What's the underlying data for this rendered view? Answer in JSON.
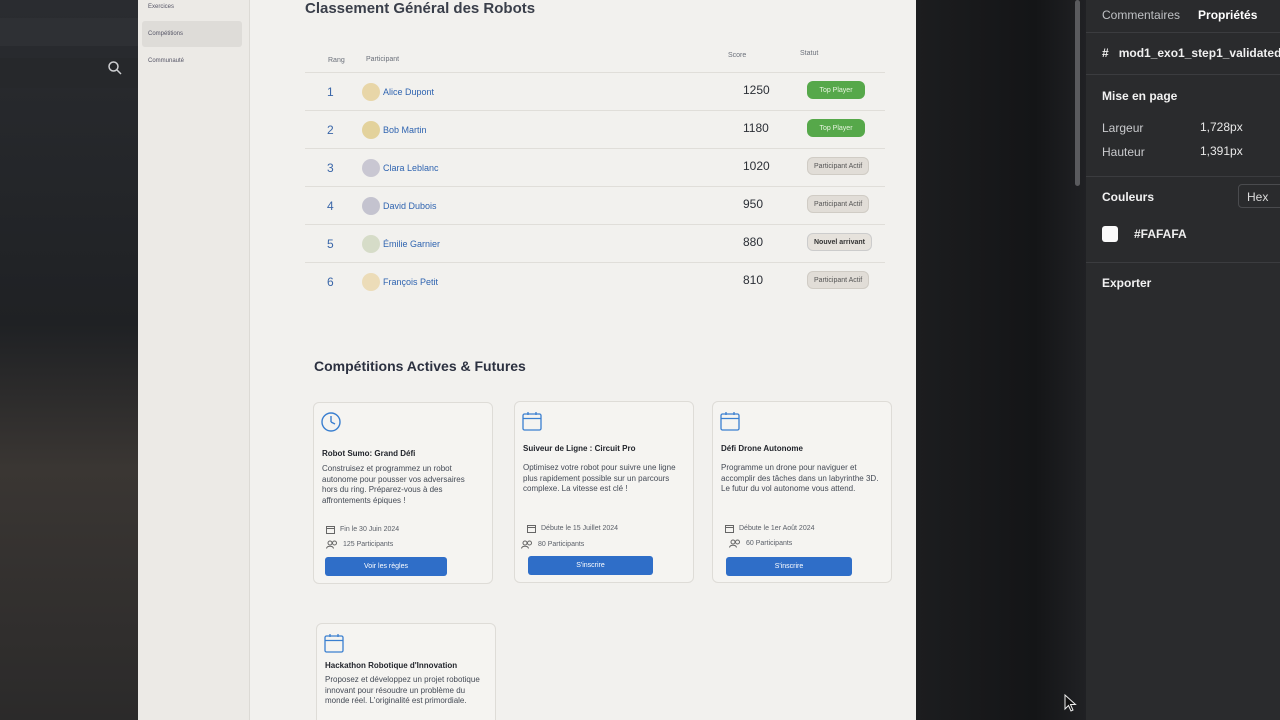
{
  "app_sidebar": {
    "items": [
      {
        "label": "Exercices"
      },
      {
        "label": "Compétitions"
      },
      {
        "label": "Communauté"
      }
    ]
  },
  "leaderboard": {
    "title": "Classement Général des Robots",
    "columns": {
      "rank": "Rang",
      "participant": "Participant",
      "score": "Score",
      "status": "Statut"
    },
    "rows": [
      {
        "rank": "1",
        "name": "Alice Dupont",
        "score": "1250",
        "status": "Top Player",
        "avatar_color": "#e8d6a8"
      },
      {
        "rank": "2",
        "name": "Bob Martin",
        "score": "1180",
        "status": "Top Player",
        "avatar_color": "#e3d29c"
      },
      {
        "rank": "3",
        "name": "Clara Leblanc",
        "score": "1020",
        "status": "Participant Actif",
        "avatar_color": "#c9c7d2"
      },
      {
        "rank": "4",
        "name": "David Dubois",
        "score": "950",
        "status": "Participant Actif",
        "avatar_color": "#c4c3cf"
      },
      {
        "rank": "5",
        "name": "Émilie Garnier",
        "score": "880",
        "status": "Nouvel arrivant",
        "avatar_color": "#d6dcc8"
      },
      {
        "rank": "6",
        "name": "François Petit",
        "score": "810",
        "status": "Participant Actif",
        "avatar_color": "#ecdcb8"
      }
    ]
  },
  "competitions": {
    "title": "Compétitions Actives & Futures",
    "cards": [
      {
        "title": "Robot Sumo: Grand Défi",
        "desc": "Construisez et programmez un robot autonome pour pousser vos adversaires hors du ring. Préparez-vous à des affrontements épiques !",
        "date": "Fin le 30 Juin 2024",
        "participants": "125 Participants",
        "button": "Voir les règles",
        "icon": "clock-icon"
      },
      {
        "title": "Suiveur de Ligne : Circuit Pro",
        "desc": "Optimisez votre robot pour suivre une ligne plus rapidement possible sur un parcours complexe. La vitesse est clé !",
        "date": "Débute le 15 Juillet 2024",
        "participants": "80 Participants",
        "button": "S'inscrire",
        "icon": "calendar-icon"
      },
      {
        "title": "Défi Drone Autonome",
        "desc": "Programme un drone pour naviguer et accomplir des tâches dans un labyrinthe 3D. Le futur du vol autonome vous attend.",
        "date": "Débute le 1er Août 2024",
        "participants": "60 Participants",
        "button": "S'inscrire",
        "icon": "calendar-icon"
      },
      {
        "title": "Hackathon Robotique d'Innovation",
        "desc": "Proposez et développez un projet robotique innovant pour résoudre un problème du monde réel. L'originalité est primordiale.",
        "icon": "calendar-icon"
      }
    ]
  },
  "properties_panel": {
    "tabs": [
      "Commentaires",
      "Propriétés"
    ],
    "selection": "mod1_exo1_step1_validated",
    "layout_title": "Mise en page",
    "width_label": "Largeur",
    "width_value": "1,728px",
    "height_label": "Hauteur",
    "height_value": "1,391px",
    "colors_title": "Couleurs",
    "color_format": "Hex",
    "color_value": "#FAFAFA",
    "export_title": "Exporter"
  },
  "colors": {
    "accent": "#2f6ec8",
    "top_badge": "#56a84a"
  }
}
